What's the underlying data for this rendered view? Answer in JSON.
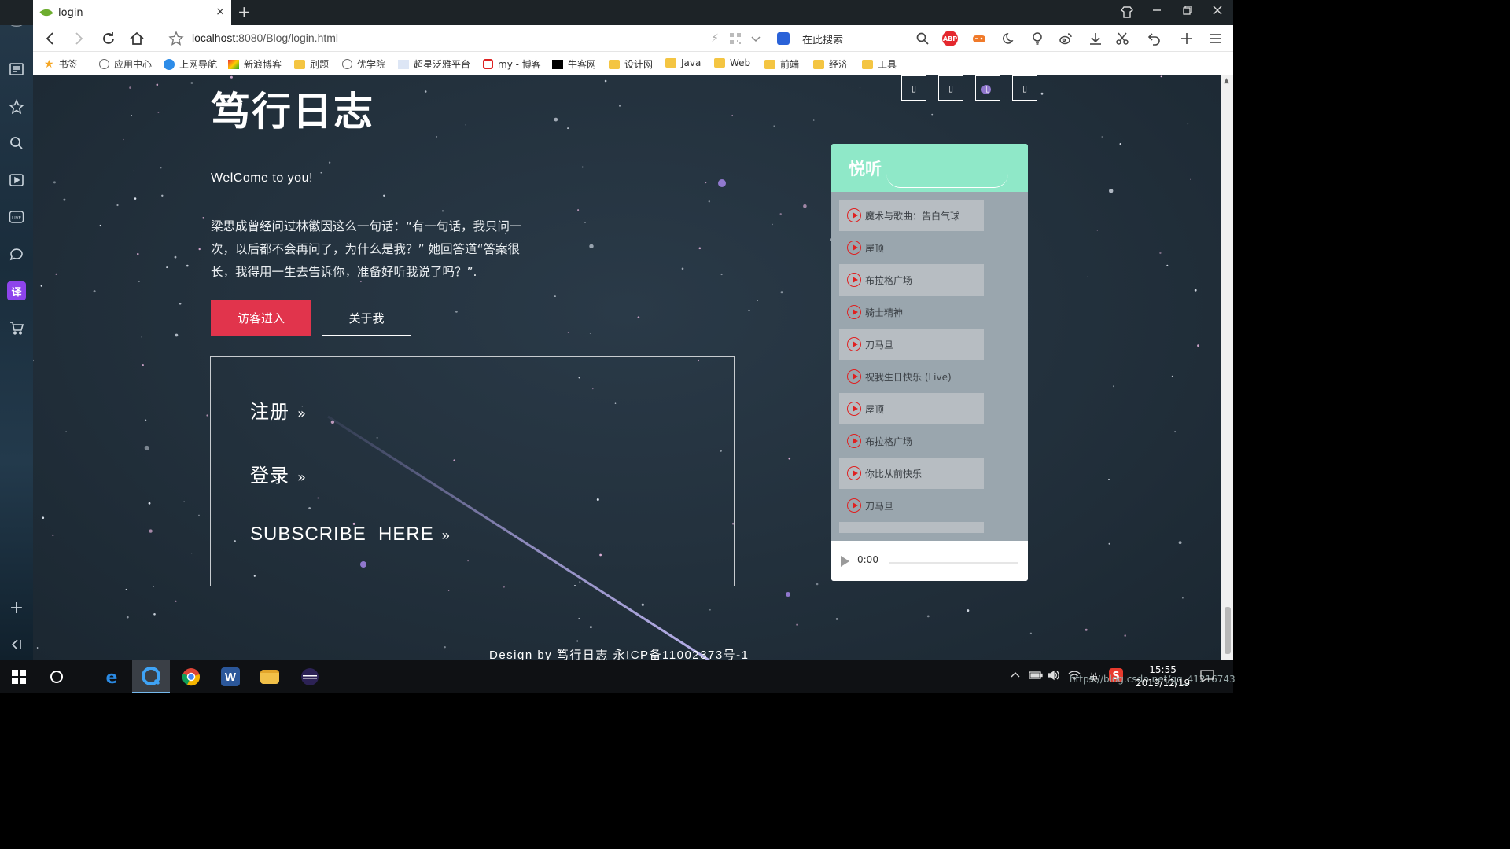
{
  "browser": {
    "tab_title": "login",
    "tab_close": "×",
    "new_tab": "+",
    "url_host": "localhost",
    "url_path": ":8080/Blog/login.html",
    "search_placeholder": "在此搜索",
    "abp_label": "ABP"
  },
  "bookmarks": [
    {
      "label": "书签",
      "icon": "star-icon"
    },
    {
      "label": "应用中心",
      "icon": "globe-icon"
    },
    {
      "label": "上网导航",
      "icon": "blue-circle-icon"
    },
    {
      "label": "新浪博客",
      "icon": "sina-icon"
    },
    {
      "label": "刷题",
      "icon": "folder-icon"
    },
    {
      "label": "优学院",
      "icon": "globe-icon"
    },
    {
      "label": "超星泛雅平台",
      "icon": "page-icon"
    },
    {
      "label": "my - 博客",
      "icon": "red-c-icon"
    },
    {
      "label": "牛客网",
      "icon": "nowcoder-icon"
    },
    {
      "label": "设计网",
      "icon": "folder-icon"
    },
    {
      "label": "Java",
      "icon": "folder-icon"
    },
    {
      "label": "Web",
      "icon": "folder-icon"
    },
    {
      "label": "前端",
      "icon": "folder-icon"
    },
    {
      "label": "经济",
      "icon": "folder-icon"
    },
    {
      "label": "工具",
      "icon": "folder-icon"
    }
  ],
  "sidebar": {
    "items": [
      "news-icon",
      "favorites-star-icon",
      "search-icon",
      "video-icon",
      "live-icon",
      "chat-icon",
      "translate-icon",
      "cart-icon",
      "add-icon",
      "collapse-icon"
    ],
    "translate_label": "译",
    "add_label": "+"
  },
  "page": {
    "site_title": "笃行日志",
    "welcome": "WelCome to you!",
    "quote": "梁思成曾经问过林徽因这么一句话：“有一句话，我只问一次，以后都不会再问了，为什么是我？” 她回答道“答案很长，我得用一生去告诉你，准备好听我说了吗？”.",
    "visit_button": "访客进入",
    "about_button": "关于我",
    "links": [
      {
        "label": "注册",
        "arrow": "»"
      },
      {
        "label": "登录",
        "arrow": "»"
      },
      {
        "label": "SUBSCRIBE  HERE",
        "arrow": "»"
      }
    ],
    "social_glyph": "▯",
    "footer": "Design by 笃行日志 永ICP备11002373号-1"
  },
  "music": {
    "title": "悦听",
    "songs": [
      "魔术与歌曲：告白气球",
      "屋顶",
      "布拉格广场",
      "骑士精神",
      "刀马旦",
      "祝我生日快乐 (Live)",
      "屋顶",
      "布拉格广场",
      "你比从前快乐",
      "刀马旦"
    ],
    "player_time": "0:00"
  },
  "taskbar": {
    "clock_time": "15:55",
    "clock_date": "2019/12/19",
    "ime_label": "英",
    "watermark": "https://blog.csdn.net/qq_41216743"
  },
  "colors": {
    "accent_red": "#e1344c",
    "music_header": "#8fe8c8",
    "music_panel": "#9aa6ae"
  }
}
